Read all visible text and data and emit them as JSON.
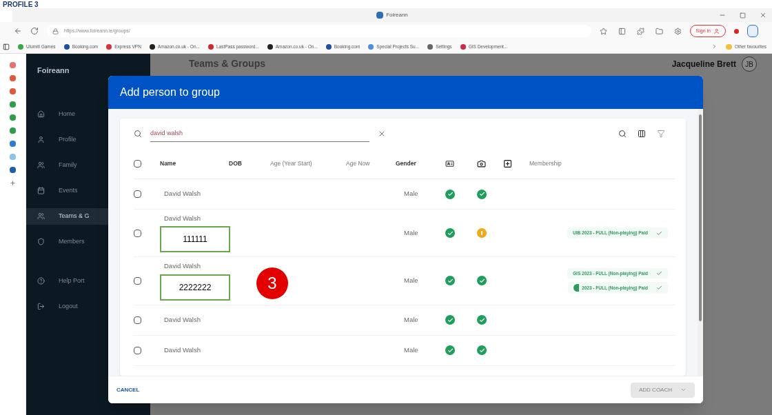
{
  "annotation_heading": "PROFILE 3",
  "browser": {
    "tab_title": "Foireann",
    "url": "https://www.foireann.ie/groups/",
    "sign_in": "Sign in",
    "bookmarks": [
      {
        "label": "Ulumiti Games",
        "color": "#3aa84a"
      },
      {
        "label": "Booking.com",
        "color": "#1f4fa0"
      },
      {
        "label": "Express VPN",
        "color": "#d9303a"
      },
      {
        "label": "Amazon.co.uk - On...",
        "color": "#222222"
      },
      {
        "label": "LastPass password...",
        "color": "#cc2b2b"
      },
      {
        "label": "Amazon.co.uk - On...",
        "color": "#222222"
      },
      {
        "label": "Booking.com",
        "color": "#1f4fa0"
      },
      {
        "label": "Special Projects Su...",
        "color": "#4a8ee0"
      },
      {
        "label": "Settings",
        "color": "#666666"
      },
      {
        "label": "GIS Development...",
        "color": "#cc2b4a"
      }
    ],
    "other_bookmarks": "Other favourites"
  },
  "app": {
    "brand": "Foireann",
    "page_title": "Teams & Groups",
    "user_name": "Jacqueline Brett",
    "user_initials": "JB",
    "nav": [
      {
        "label": "Home",
        "selected": false
      },
      {
        "label": "Profile",
        "selected": false
      },
      {
        "label": "Family",
        "selected": false
      },
      {
        "label": "Events",
        "selected": false
      },
      {
        "label": "Teams & G",
        "selected": true
      },
      {
        "label": "Members",
        "selected": false
      },
      {
        "label": "Help Port",
        "selected": false
      },
      {
        "label": "Logout",
        "selected": false
      }
    ]
  },
  "dialog": {
    "title": "Add person to group",
    "search": {
      "value": "david walsh"
    },
    "select_all_checked": false,
    "columns": [
      "Name",
      "DOB",
      "Age (Year Start)",
      "Age Now",
      "Gender",
      "Membership"
    ],
    "rows": [
      {
        "checked": false,
        "name": "David Walsh",
        "gender": "Male",
        "checks": [
          {
            "complete": true
          },
          {
            "complete": true
          }
        ],
        "memberships": []
      },
      {
        "checked": false,
        "name": "David Walsh",
        "annotated_id": "111111",
        "gender": "Male",
        "checks": [
          {
            "complete": true
          },
          {
            "complete": false
          }
        ],
        "memberships": [
          {
            "label": "UIB 2023 - FULL (Non-playing) Paid",
            "kind": "plain"
          }
        ]
      },
      {
        "checked": false,
        "name": "David Walsh",
        "annotated_id": "2222222",
        "gender": "Male",
        "checks": [
          {
            "complete": true
          },
          {
            "complete": true
          }
        ],
        "memberships": [
          {
            "label": "GIS 2023 - FULL (Non-playing) Paid",
            "kind": "plain"
          },
          {
            "label": "2023 - FULL (Non-playing) Paid",
            "kind": "crest"
          }
        ]
      },
      {
        "checked": false,
        "name": "David Walsh",
        "gender": "Male",
        "checks": [
          {
            "complete": true
          },
          {
            "complete": true
          }
        ],
        "memberships": []
      },
      {
        "checked": false,
        "name": "David Walsh",
        "gender": "Male",
        "checks": [
          {
            "complete": true
          },
          {
            "complete": true
          }
        ],
        "memberships": []
      }
    ],
    "cancel": "CANCEL",
    "primary": "ADD COACH",
    "primary_disabled": true
  },
  "step_marker": "3"
}
